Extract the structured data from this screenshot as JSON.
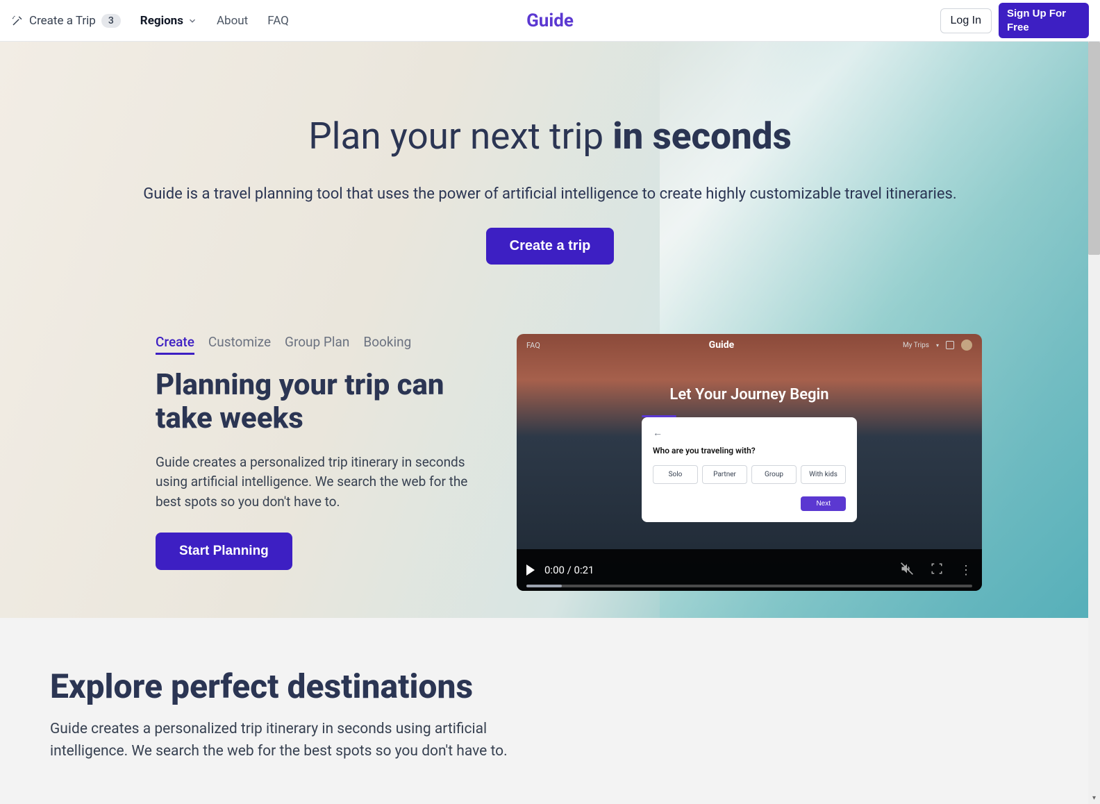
{
  "header": {
    "create_trip_label": "Create a Trip",
    "create_trip_badge": "3",
    "regions_label": "Regions",
    "about_label": "About",
    "faq_label": "FAQ",
    "logo": "Guide",
    "login_label": "Log In",
    "signup_label": "Sign Up For Free"
  },
  "hero": {
    "title_normal": "Plan your next trip ",
    "title_bold": "in seconds",
    "subtitle": "Guide is a travel planning tool that uses the power of artificial intelligence to create highly customizable travel itineraries.",
    "cta_label": "Create a trip"
  },
  "feature": {
    "tabs": [
      "Create",
      "Customize",
      "Group Plan",
      "Booking"
    ],
    "active_tab_index": 0,
    "title": "Planning your trip can take weeks",
    "desc": "Guide creates a personalized trip itinerary in seconds using artificial intelligence. We search the web for the best spots so you don't have to.",
    "start_label": "Start Planning"
  },
  "video": {
    "faq_label": "FAQ",
    "logo": "Guide",
    "mytrips_label": "My Trips",
    "hero_title": "Let Your Journey Begin",
    "card_question": "Who are you traveling with?",
    "options": [
      "Solo",
      "Partner",
      "Group",
      "With kids"
    ],
    "next_label": "Next",
    "time": "0:00 / 0:21"
  },
  "destinations": {
    "title": "Explore perfect destinations",
    "desc": "Guide creates a personalized trip itinerary in seconds using artificial intelligence. We search the web for the best spots so you don't have to."
  }
}
